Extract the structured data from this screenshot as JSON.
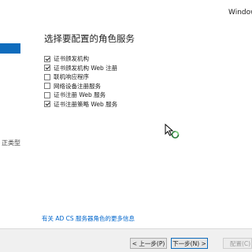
{
  "window": {
    "title": "Windows"
  },
  "nav": {
    "partial_item": "正类型"
  },
  "heading": "选择要配置的角色服务",
  "roles": [
    {
      "label": "证书颁发机构",
      "checked": true
    },
    {
      "label": "证书颁发机构 Web 注册",
      "checked": true
    },
    {
      "label": "联机响应程序",
      "checked": false
    },
    {
      "label": "网络设备注册服务",
      "checked": false
    },
    {
      "label": "证书注册 Web 服务",
      "checked": false
    },
    {
      "label": "证书注册策略 Web 服务",
      "checked": true
    }
  ],
  "more_info_link": "有关 AD CS 服务器角色的更多信息",
  "buttons": {
    "back": "< 上一步(P)",
    "next": "下一步(N) >",
    "install": "配置(C)"
  },
  "colors": {
    "accent": "#0f6cbd",
    "link": "#0066cc"
  }
}
